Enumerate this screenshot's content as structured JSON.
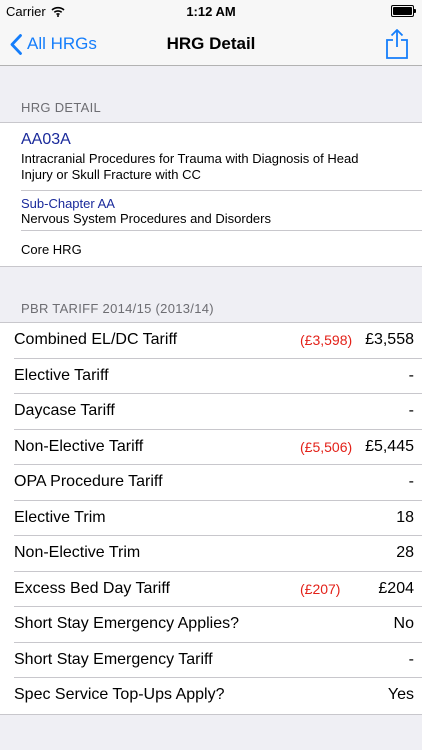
{
  "status": {
    "carrier": "Carrier",
    "time": "1:12 AM"
  },
  "nav": {
    "back_label": "All HRGs",
    "title": "HRG Detail"
  },
  "hrg_detail": {
    "header": "HRG DETAIL",
    "code": "AA03A",
    "description_line1": "Intracranial Procedures for Trauma with Diagnosis of Head",
    "description_line2": "Injury or Skull Fracture with CC",
    "subchapter_title": "Sub-Chapter AA",
    "subchapter_desc": "Nervous System Procedures and Disorders",
    "type": "Core HRG"
  },
  "tariff": {
    "header": "PBR TARIFF 2014/15 (2013/14)",
    "rows": [
      {
        "label": "Combined EL/DC Tariff",
        "old": "(£3,598)",
        "value": "£3,558"
      },
      {
        "label": "Elective Tariff",
        "old": "",
        "value": "-"
      },
      {
        "label": "Daycase Tariff",
        "old": "",
        "value": "-"
      },
      {
        "label": "Non-Elective Tariff",
        "old": "(£5,506)",
        "value": "£5,445"
      },
      {
        "label": "OPA Procedure Tariff",
        "old": "",
        "value": "-"
      },
      {
        "label": "Elective Trim",
        "old": "",
        "value": "18"
      },
      {
        "label": "Non-Elective Trim",
        "old": "",
        "value": "28"
      },
      {
        "label": "Excess Bed Day Tariff",
        "old": "(£207)",
        "value": "£204"
      },
      {
        "label": "Short Stay Emergency Applies?",
        "old": "",
        "value": "No"
      },
      {
        "label": "Short Stay Emergency Tariff",
        "old": "",
        "value": "-"
      },
      {
        "label": "Spec Service Top-Ups Apply?",
        "old": "",
        "value": "Yes"
      }
    ]
  },
  "colors": {
    "accent": "#157efb",
    "old_value": "#e32119",
    "code": "#1a2a9b"
  }
}
